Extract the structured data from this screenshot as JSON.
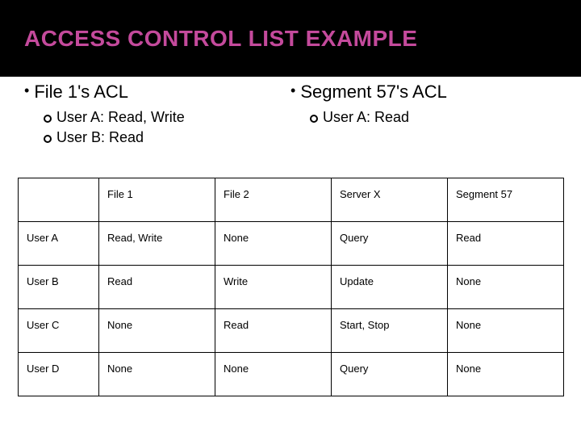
{
  "title": "ACCESS CONTROL LIST EXAMPLE",
  "columns": [
    {
      "heading": "File 1's ACL",
      "items": [
        "User A:  Read, Write",
        "User B:  Read"
      ]
    },
    {
      "heading": "Segment 57's ACL",
      "items": [
        "User A:  Read"
      ]
    }
  ],
  "table": {
    "headers": [
      "",
      "File 1",
      "File 2",
      "Server X",
      "Segment 57"
    ],
    "rows": [
      [
        "User A",
        "Read, Write",
        "None",
        "Query",
        "Read"
      ],
      [
        "User B",
        "Read",
        "Write",
        "Update",
        "None"
      ],
      [
        "User C",
        "None",
        "Read",
        "Start, Stop",
        "None"
      ],
      [
        "User D",
        "None",
        "None",
        "Query",
        "None"
      ]
    ]
  }
}
